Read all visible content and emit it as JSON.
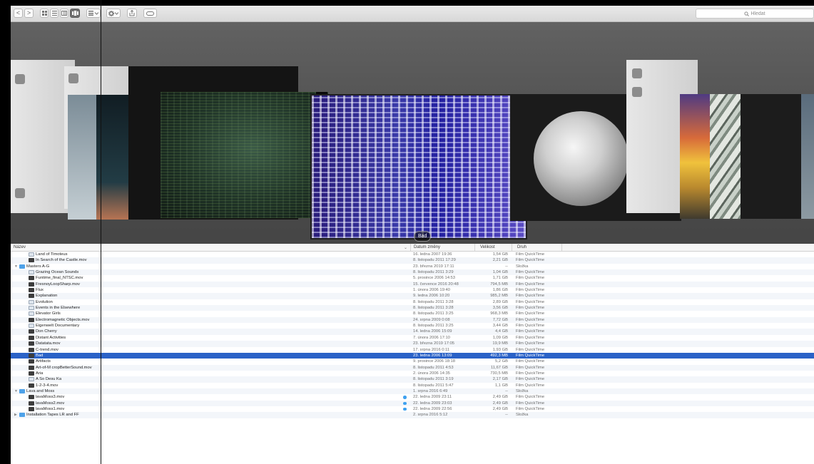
{
  "toolbar": {
    "back_label": "<",
    "forward_label": ">",
    "search_placeholder": "Hledat"
  },
  "coverflow": {
    "caption": "Bad"
  },
  "columns": {
    "name": "Název",
    "date": "Datum změny",
    "size": "Velikost",
    "kind": "Druh"
  },
  "rows": [
    {
      "indent": 1,
      "icon": "doc",
      "name": "Land of Timoteus",
      "date": "16. ledna 2007 19:36",
      "size": "1,54 GB",
      "kind": "Film QuickTime"
    },
    {
      "indent": 1,
      "icon": "file",
      "name": "In Search of the Castle.mov",
      "date": "8. listopadu 2011 17:29",
      "size": "2,21 GB",
      "kind": "Film QuickTime"
    },
    {
      "indent": 0,
      "icon": "folder",
      "toggle": "▼",
      "name": "Masters A-G",
      "date": "23. března 2019 17:11",
      "size": "--",
      "kind": "Složka"
    },
    {
      "indent": 1,
      "icon": "doc",
      "name": "Grazing Ocean Sounds",
      "date": "8. listopadu 2011 3:29",
      "size": "1,04 GB",
      "kind": "Film QuickTime"
    },
    {
      "indent": 1,
      "icon": "file",
      "name": "Funtime_final_NTSC.mov",
      "date": "5. prosince 2006 14:53",
      "size": "1,71 GB",
      "kind": "Film QuickTime"
    },
    {
      "indent": 1,
      "icon": "file",
      "name": "FresnoyLoopSharp.mov",
      "date": "15. července 2016 20:48",
      "size": "794,5 MB",
      "kind": "Film QuickTime"
    },
    {
      "indent": 1,
      "icon": "file",
      "name": "Flux",
      "date": "1. února 2006 19:40",
      "size": "1,86 GB",
      "kind": "Film QuickTime"
    },
    {
      "indent": 1,
      "icon": "file",
      "name": "Explanation",
      "date": "9. ledna 2006 10:20",
      "size": "985,2 MB",
      "kind": "Film QuickTime"
    },
    {
      "indent": 1,
      "icon": "doc",
      "name": "Evolution",
      "date": "8. listopadu 2011 3:28",
      "size": "2,89 GB",
      "kind": "Film QuickTime"
    },
    {
      "indent": 1,
      "icon": "doc",
      "name": "Events in the Elsewhere",
      "date": "8. listopadu 2011 3:28",
      "size": "3,56 GB",
      "kind": "Film QuickTime"
    },
    {
      "indent": 1,
      "icon": "doc",
      "name": "Elevator Girls",
      "date": "8. listopadu 2011 3:25",
      "size": "968,3 MB",
      "kind": "Film QuickTime"
    },
    {
      "indent": 1,
      "icon": "file",
      "name": "Electromagnetic Objects.mov",
      "date": "24. srpna 2009 0:08",
      "size": "7,72 GB",
      "kind": "Film QuickTime"
    },
    {
      "indent": 1,
      "icon": "doc",
      "name": "Eigenwelt Documentary",
      "date": "8. listopadu 2011 3:25",
      "size": "3,44 GB",
      "kind": "Film QuickTime"
    },
    {
      "indent": 1,
      "icon": "file",
      "name": "Don Cherry",
      "date": "14. ledna 2006 15:09",
      "size": "4,4 GB",
      "kind": "Film QuickTime"
    },
    {
      "indent": 1,
      "icon": "file",
      "name": "Distant Activities",
      "date": "7. února 2006 17:10",
      "size": "1,09 GB",
      "kind": "Film QuickTime"
    },
    {
      "indent": 1,
      "icon": "file",
      "name": "Datatata.mov",
      "date": "23. března 2019 17:05",
      "size": "19,9 MB",
      "kind": "Film QuickTime"
    },
    {
      "indent": 1,
      "icon": "file",
      "name": "C-trend.mov",
      "date": "17. srpna 2016 0:11",
      "size": "1,93 GB",
      "kind": "Film QuickTime"
    },
    {
      "indent": 1,
      "icon": "file",
      "name": "Bad",
      "date": "23. ledna 2006 13:09",
      "size": "492,3 MB",
      "kind": "Film QuickTime",
      "selected": true
    },
    {
      "indent": 1,
      "icon": "file",
      "name": "Artifacts",
      "date": "9. prosince 2006 18:18",
      "size": "5,2 GB",
      "kind": "Film QuickTime"
    },
    {
      "indent": 1,
      "icon": "file",
      "name": "Art-of-M cropBetterSound.mov",
      "date": "8. listopadu 2011 4:53",
      "size": "11,67 GB",
      "kind": "Film QuickTime"
    },
    {
      "indent": 1,
      "icon": "file",
      "name": "Aria",
      "date": "2. února 2006 14:35",
      "size": "730,5 MB",
      "kind": "Film QuickTime"
    },
    {
      "indent": 1,
      "icon": "doc",
      "name": "A So Desu Ka",
      "date": "8. listopadu 2011 3:19",
      "size": "2,17 GB",
      "kind": "Film QuickTime"
    },
    {
      "indent": 1,
      "icon": "file",
      "name": "1-2-3-4.mov",
      "date": "8. listopadu 2011 5:47",
      "size": "1,1 GB",
      "kind": "Film QuickTime"
    },
    {
      "indent": 0,
      "icon": "folder",
      "toggle": "▼",
      "name": "Lava and Moss",
      "date": "1. srpna 2016 6:49",
      "size": "--",
      "kind": "Složka"
    },
    {
      "indent": 1,
      "icon": "file",
      "name": "lavaMoss3.mov",
      "date": "22. ledna 2009 23:11",
      "size": "2,49 GB",
      "kind": "Film QuickTime",
      "tag": true
    },
    {
      "indent": 1,
      "icon": "file",
      "name": "lavaMoss2.mov",
      "date": "22. ledna 2009 23:03",
      "size": "2,49 GB",
      "kind": "Film QuickTime",
      "tag": true
    },
    {
      "indent": 1,
      "icon": "file",
      "name": "lavaMoss1.mov",
      "date": "22. ledna 2009 22:56",
      "size": "2,49 GB",
      "kind": "Film QuickTime",
      "tag": true
    },
    {
      "indent": 0,
      "icon": "folder",
      "toggle": "▶",
      "name": "Installation Tapes LR and FF",
      "date": "2. srpna 2016 5:12",
      "size": "--",
      "kind": "Složka"
    }
  ],
  "colors": {
    "selection": "#2a62c7",
    "folder": "#4ea2e9",
    "tag": "#3ea1f0"
  }
}
